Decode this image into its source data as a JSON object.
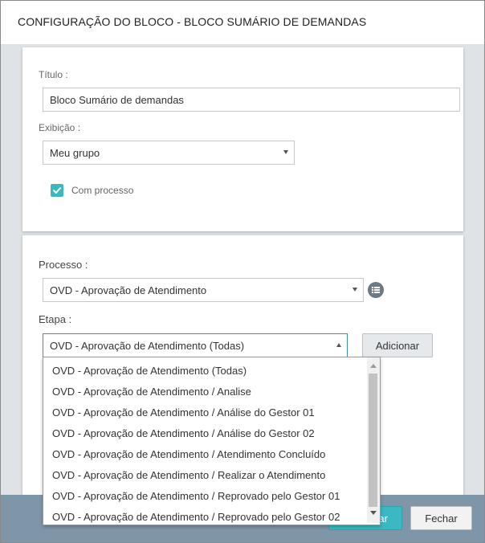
{
  "dialog": {
    "title": "CONFIGURAÇÃO DO BLOCO - BLOCO SUMÁRIO DE DEMANDAS"
  },
  "general": {
    "title_label": "Título :",
    "title_value": "Bloco Sumário de demandas",
    "display_label": "Exibição :",
    "display_value": "Meu grupo",
    "with_process_label": "Com processo",
    "with_process_checked": true
  },
  "process": {
    "process_label": "Processo :",
    "process_value": "OVD - Aprovação de Atendimento",
    "stage_label": "Etapa :",
    "stage_value": "OVD - Aprovação de Atendimento (Todas)",
    "add_label": "Adicionar",
    "list_icon": "list-icon"
  },
  "stage_options": [
    "OVD - Aprovação de Atendimento (Todas)",
    "OVD - Aprovação de Atendimento / Analise",
    "OVD - Aprovação de Atendimento / Análise do Gestor 01",
    "OVD - Aprovação de Atendimento / Análise do Gestor 02",
    "OVD - Aprovação de Atendimento / Atendimento Concluído",
    "OVD - Aprovação de Atendimento / Realizar o Atendimento",
    "OVD - Aprovação de Atendimento / Reprovado pelo Gestor 01",
    "OVD - Aprovação de Atendimento / Reprovado pelo Gestor 02"
  ],
  "footer": {
    "save_label_partial": "lvar",
    "close_label": "Fechar"
  },
  "colors": {
    "accent": "#3cb8c2",
    "footer": "#7f95a8"
  }
}
